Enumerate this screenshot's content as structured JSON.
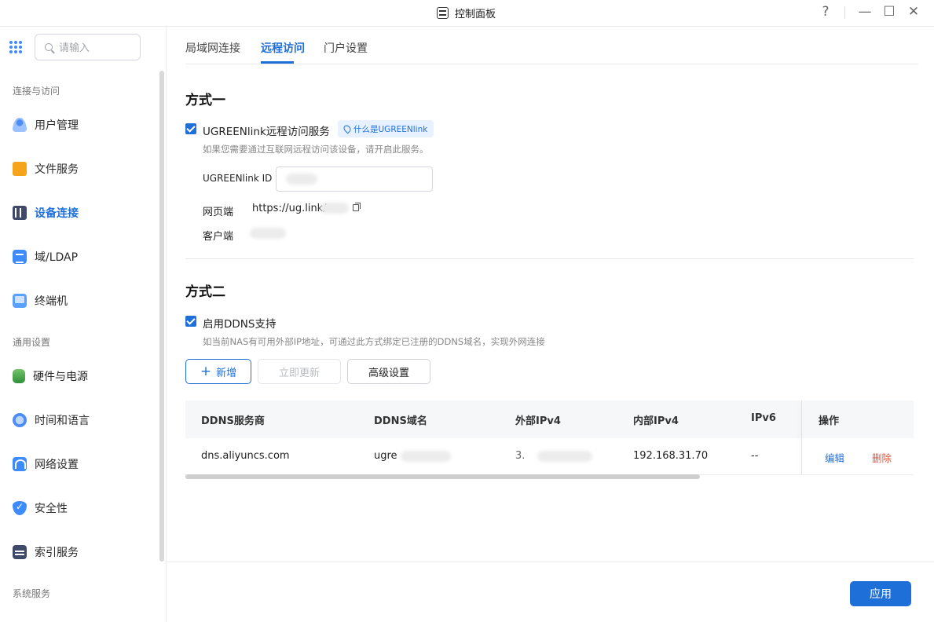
{
  "window": {
    "title": "控制面板",
    "help": "?",
    "minimize": "—",
    "maximize": "☐",
    "close": "✕"
  },
  "sidebar": {
    "search_placeholder": "请输入",
    "groups": [
      "连接与访问",
      "通用设置",
      "系统服务"
    ],
    "items": [
      {
        "label": "用户管理",
        "icon": "user-management-icon"
      },
      {
        "label": "文件服务",
        "icon": "folder-icon"
      },
      {
        "label": "设备连接",
        "icon": "device-connection-icon",
        "active": true
      },
      {
        "label": "域/LDAP",
        "icon": "ldap-icon"
      },
      {
        "label": "终端机",
        "icon": "terminal-icon"
      },
      {
        "label": "硬件与电源",
        "icon": "hardware-power-icon"
      },
      {
        "label": "时间和语言",
        "icon": "globe-icon"
      },
      {
        "label": "网络设置",
        "icon": "network-icon"
      },
      {
        "label": "安全性",
        "icon": "shield-icon"
      },
      {
        "label": "索引服务",
        "icon": "index-icon"
      }
    ]
  },
  "tabs": [
    {
      "label": "局域网连接"
    },
    {
      "label": "远程访问",
      "active": true
    },
    {
      "label": "门户设置"
    }
  ],
  "method1": {
    "title": "方式一",
    "checkbox_label": "UGREENlink远程访问服务",
    "checked": true,
    "what_is": "什么是UGREENlink",
    "hint": "如果您需要通过互联网远程访问该设备，请开启此服务。",
    "id_label": "UGREENlink ID",
    "web_label": "网页端",
    "web_url": "https://ug.link/",
    "client_label": "客户端"
  },
  "method2": {
    "title": "方式二",
    "checkbox_label": "启用DDNS支持",
    "checked": true,
    "hint": "如当前NAS有可用外部IP地址，可通过此方式绑定已注册的DDNS域名，实现外网连接",
    "add_button": "新增",
    "add_icon": "+",
    "refresh_button": "立即更新",
    "advanced_button": "高级设置"
  },
  "table": {
    "headers": [
      "DDNS服务商",
      "DDNS域名",
      "外部IPv4",
      "内部IPv4",
      "IPv6",
      "操作"
    ],
    "rows": [
      {
        "provider": "dns.aliyuncs.com",
        "domain": "ugre",
        "external": "3.",
        "internal": "192.168.31.70",
        "ipv6": "--",
        "edit": "编辑",
        "delete": "删除"
      }
    ]
  },
  "footer": {
    "apply_button": "应用"
  },
  "colors": {
    "accent": "#1f6fd8",
    "danger": "#e8503a"
  }
}
